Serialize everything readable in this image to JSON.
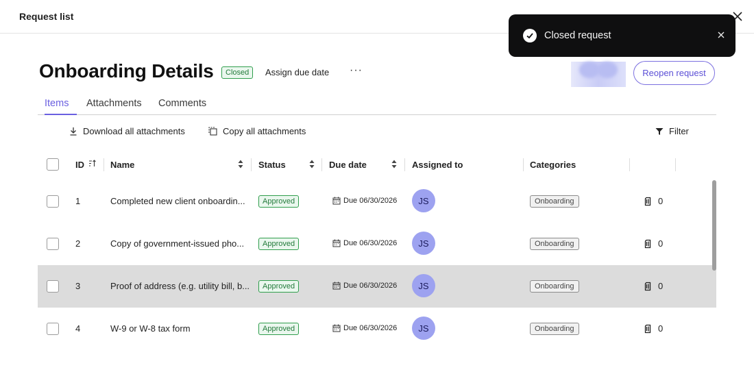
{
  "header": {
    "title": "Request list"
  },
  "toast": {
    "message": "Closed request"
  },
  "request": {
    "title": "Onboarding Details",
    "status_badge": "Closed",
    "assign_due_date": "Assign due date",
    "more": "···",
    "reopen_label": "Reopen request"
  },
  "tabs": [
    {
      "label": "Items",
      "active": true
    },
    {
      "label": "Attachments",
      "active": false
    },
    {
      "label": "Comments",
      "active": false
    }
  ],
  "actions": {
    "download_all": "Download all attachments",
    "copy_all": "Copy all attachments",
    "filter": "Filter"
  },
  "table": {
    "columns": {
      "id": "ID",
      "name": "Name",
      "status": "Status",
      "due_date": "Due date",
      "assigned_to": "Assigned to",
      "categories": "Categories"
    },
    "rows": [
      {
        "id": "1",
        "name": "Completed new client onboardin...",
        "status": "Approved",
        "due": "Due 06/30/2026",
        "assignee": "JS",
        "category": "Onboarding",
        "attachments": "0"
      },
      {
        "id": "2",
        "name": "Copy of government-issued pho...",
        "status": "Approved",
        "due": "Due 06/30/2026",
        "assignee": "JS",
        "category": "Onboarding",
        "attachments": "0"
      },
      {
        "id": "3",
        "name": "Proof of address (e.g. utility bill, b...",
        "status": "Approved",
        "due": "Due 06/30/2026",
        "assignee": "JS",
        "category": "Onboarding",
        "attachments": "0"
      },
      {
        "id": "4",
        "name": "W-9 or W-8 tax form",
        "status": "Approved",
        "due": "Due 06/30/2026",
        "assignee": "JS",
        "category": "Onboarding",
        "attachments": "0"
      }
    ]
  },
  "colors": {
    "accent": "#6a5fe0",
    "approved": "#2e9d4b",
    "avatar": "#9da2f0",
    "toast_bg": "#0f0f10",
    "row_highlight": "#dcdcdc"
  },
  "icons": {
    "close": "close-icon",
    "check": "check-circle-icon",
    "download": "download-icon",
    "copy": "copy-icon",
    "filter": "filter-icon",
    "sort": "sort-icon",
    "calendar": "calendar-icon",
    "attachment": "paperclip-icon"
  }
}
